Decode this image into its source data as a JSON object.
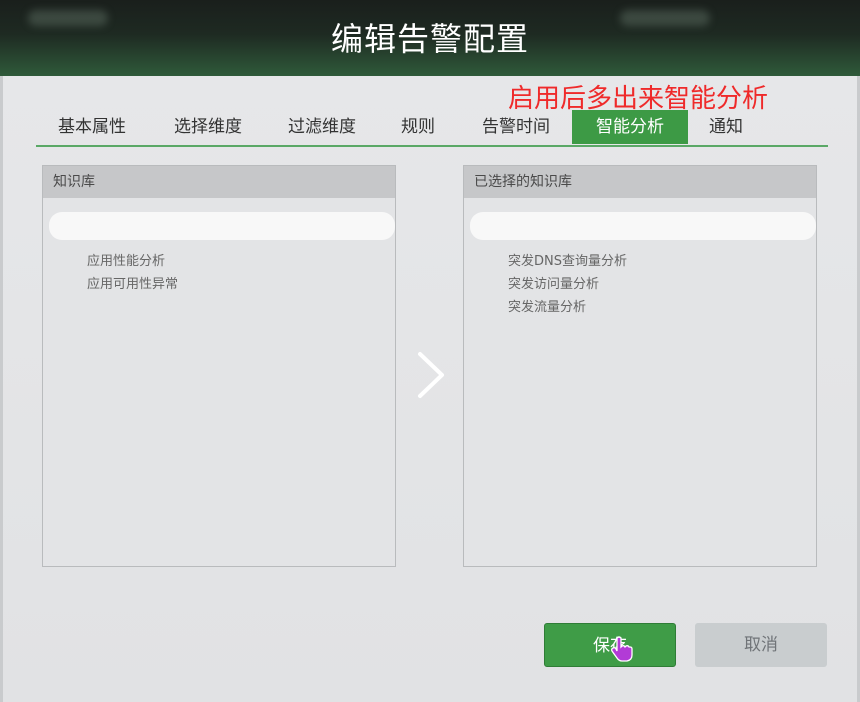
{
  "dialog": {
    "title": "编辑告警配置"
  },
  "annotation": "启用后多出来智能分析",
  "tabs": [
    {
      "label": "基本属性",
      "active": false
    },
    {
      "label": "选择维度",
      "active": false
    },
    {
      "label": "过滤维度",
      "active": false
    },
    {
      "label": "规则",
      "active": false
    },
    {
      "label": "告警时间",
      "active": false
    },
    {
      "label": "智能分析",
      "active": true
    },
    {
      "label": "通知",
      "active": false
    }
  ],
  "left_panel": {
    "header": "知识库",
    "search_value": "",
    "items": [
      "应用性能分析",
      "应用可用性异常"
    ]
  },
  "right_panel": {
    "header": "已选择的知识库",
    "search_value": "",
    "items": [
      "突发DNS查询量分析",
      "突发访问量分析",
      "突发流量分析"
    ]
  },
  "transfer_icon": "chevron-right-icon",
  "buttons": {
    "save": "保存",
    "cancel": "取消"
  },
  "colors": {
    "accent": "#3d9a45",
    "annotation": "#ef2a2a"
  }
}
